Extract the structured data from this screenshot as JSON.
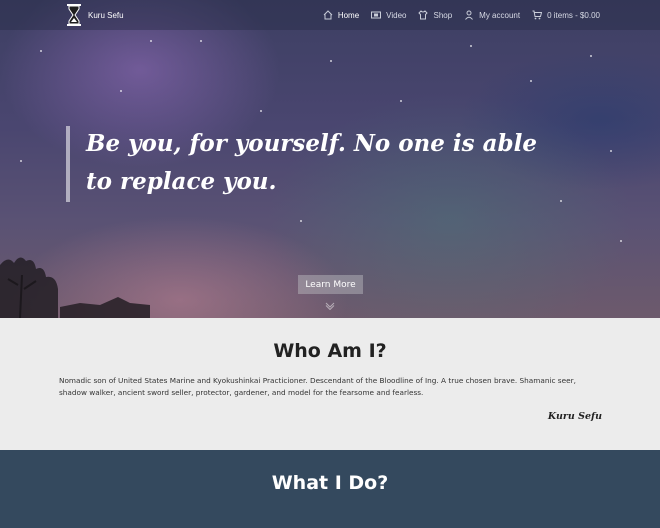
{
  "header": {
    "brand_name": "Kuru Sefu",
    "nav": [
      {
        "label": "Home",
        "icon": "home-icon",
        "active": true
      },
      {
        "label": "Video",
        "icon": "video-icon",
        "active": false
      },
      {
        "label": "Shop",
        "icon": "shirt-icon",
        "active": false
      },
      {
        "label": "My account",
        "icon": "user-icon",
        "active": false
      },
      {
        "label": "0 items - $0.00",
        "icon": "cart-icon",
        "active": false
      }
    ]
  },
  "hero": {
    "quote": "Be you, for yourself. No one is able to replace you.",
    "button_label": "Learn More"
  },
  "about": {
    "title": "Who Am I?",
    "text": "Nomadic son of United States Marine and Kyokushinkai Practicioner. Descendant of the Bloodline of Ing. A true chosen brave. Shamanic seer, shadow walker, ancient sword seller, protector, gardener, and model for the fearsome and fearless.",
    "signature": "Kuru Sefu"
  },
  "services": {
    "title": "What I Do?"
  },
  "colors": {
    "services_bg": "#34495e",
    "about_bg": "#ececec"
  }
}
